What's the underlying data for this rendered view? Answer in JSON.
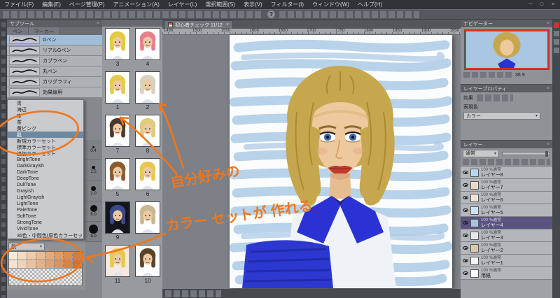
{
  "window": {
    "controls": [
      "─",
      "□",
      "×"
    ]
  },
  "menu_bar": {
    "items": [
      "ファイル(F)",
      "編集(E)",
      "ページ管理(P)",
      "アニメーション(A)",
      "レイヤー(L)",
      "選択範囲(S)",
      "表示(V)",
      "フィルター(I)",
      "ウィンドウ(W)",
      "ヘルプ(H)"
    ]
  },
  "toolbar": {
    "help_icon": "?"
  },
  "subtool_panel": {
    "title": "サブツール",
    "menu_icon": "≡",
    "tabs": [
      "ペン",
      "マーカー"
    ],
    "tools": [
      {
        "name": "Gペン",
        "selected": true
      },
      {
        "name": "リアルGペン"
      },
      {
        "name": "カブラペン"
      },
      {
        "name": "丸ペン"
      },
      {
        "name": "カリグラフィ"
      },
      {
        "name": "効果線用"
      }
    ]
  },
  "colorset_dropdown": {
    "items": [
      {
        "label": "青"
      },
      {
        "label": "海辺"
      },
      {
        "label": "空"
      },
      {
        "label": "茶"
      },
      {
        "label": "黄ピンク"
      },
      {
        "label": "肌",
        "selected": true
      },
      {
        "label": "新規カラーセット"
      },
      {
        "label": "標準カラーセット"
      },
      {
        "label": "追加カラーセット"
      },
      {
        "label": "BrightTone"
      },
      {
        "label": "DarkGrayish"
      },
      {
        "label": "DarkTone"
      },
      {
        "label": "DeepTone"
      },
      {
        "label": "DullTone"
      },
      {
        "label": "Grayish"
      },
      {
        "label": "LightGrayish"
      },
      {
        "label": "LightTone"
      },
      {
        "label": "PaleTone"
      },
      {
        "label": "SoftTone"
      },
      {
        "label": "StrongTone"
      },
      {
        "label": "VividTone"
      },
      {
        "label": "36色・中間色(原色カラーセット)"
      }
    ]
  },
  "color_palette": {
    "selected_set": "肌",
    "swatches": [
      "#f8ead9",
      "#f3dcc2",
      "#eeccab",
      "#e8bd94",
      "#e2ad7e",
      "#db9e69",
      "#d49055",
      "#cc8142",
      "#f6e2d2",
      "#f0d2ba",
      "#eac2a2",
      "#e3b28b",
      "#dda375",
      "#d69460",
      "#cf854c",
      "#c77639"
    ]
  },
  "brush_sizes": {
    "presets": [
      {
        "value": "0.4"
      },
      {
        "value": "1.5"
      },
      {
        "value": "2.0"
      },
      {
        "value": "6.0"
      },
      {
        "value": "8.0"
      }
    ]
  },
  "thumbnail_panel": {
    "items": [
      {
        "num": "3",
        "hair": "#e3c93f",
        "bg": "#ffffff"
      },
      {
        "num": "4",
        "hair": "#e8808e",
        "bg": "#ffffff"
      },
      {
        "num": "1",
        "hair": "#e6c94e",
        "bg": "#ffffff"
      },
      {
        "num": "2",
        "hair": "#d9d2c0",
        "bg": "#ffffff"
      },
      {
        "num": "7",
        "hair": "#4a3828",
        "bg": "#ffffff"
      },
      {
        "num": "8",
        "hair": "#e0cc7a",
        "bg": "#ffffff"
      },
      {
        "num": "5",
        "hair": "#8a5a30",
        "bg": "#ffffff"
      },
      {
        "num": "6",
        "hair": "#e6c94e",
        "bg": "#ffffff"
      },
      {
        "num": "9",
        "hair": "#3a4a8a",
        "bg": "#15151d"
      },
      {
        "num": "",
        "hair": "#c8b890",
        "bg": "#ffffff"
      },
      {
        "num": "11",
        "hair": "#e6c94e",
        "bg": "#f5e8e0"
      },
      {
        "num": "10",
        "hair": "#5a4228",
        "bg": "#ffffff"
      }
    ]
  },
  "canvas": {
    "tab": {
      "title": "初心者チェック 11/12",
      "close": "×"
    },
    "ruler_labels": [
      "1450",
      "1500",
      "1550",
      "1600",
      "1650",
      "1700",
      "1750",
      "1800",
      "1850",
      "1900",
      "1950"
    ]
  },
  "annotation": {
    "color": "#f0761c",
    "line1": "自分好みの",
    "line2": "カラー セットが 作れる"
  },
  "navigator": {
    "title": "ナビゲーター",
    "zoom_value": "36.9"
  },
  "layer_property": {
    "title": "レイヤープロパティ",
    "effect_label": "効果",
    "expression_label": "表現色",
    "expression_value": "カラー"
  },
  "layers_panel": {
    "title": "レイヤー",
    "blend_mode": "通常",
    "rows": [
      {
        "info": "100 %通常",
        "name": "レイヤー8",
        "thumb": "#bcd4ea"
      },
      {
        "info": "100 %通常",
        "name": "レイヤー7",
        "thumb": "#e9d9c9"
      },
      {
        "info": "100 %通常",
        "name": "レイヤー6",
        "thumb": "#f0e4d4"
      },
      {
        "info": "100 %通常",
        "name": "レイヤー5",
        "thumb": "#cfe0ef"
      },
      {
        "info": "100 %通常",
        "name": "レイヤー4",
        "thumb": "#a9c2de",
        "selected": true
      },
      {
        "info": "100 %通常",
        "name": "レイヤー3",
        "thumb": "#e6e6e6"
      },
      {
        "info": "100 %通常",
        "name": "レイヤー2",
        "thumb": "#d9c9ae"
      },
      {
        "info": "100 %通常",
        "name": "レイヤー1",
        "thumb": "#f4f4f4"
      },
      {
        "info": "100 %通常",
        "name": "用紙",
        "thumb": "#ffffff"
      }
    ]
  }
}
